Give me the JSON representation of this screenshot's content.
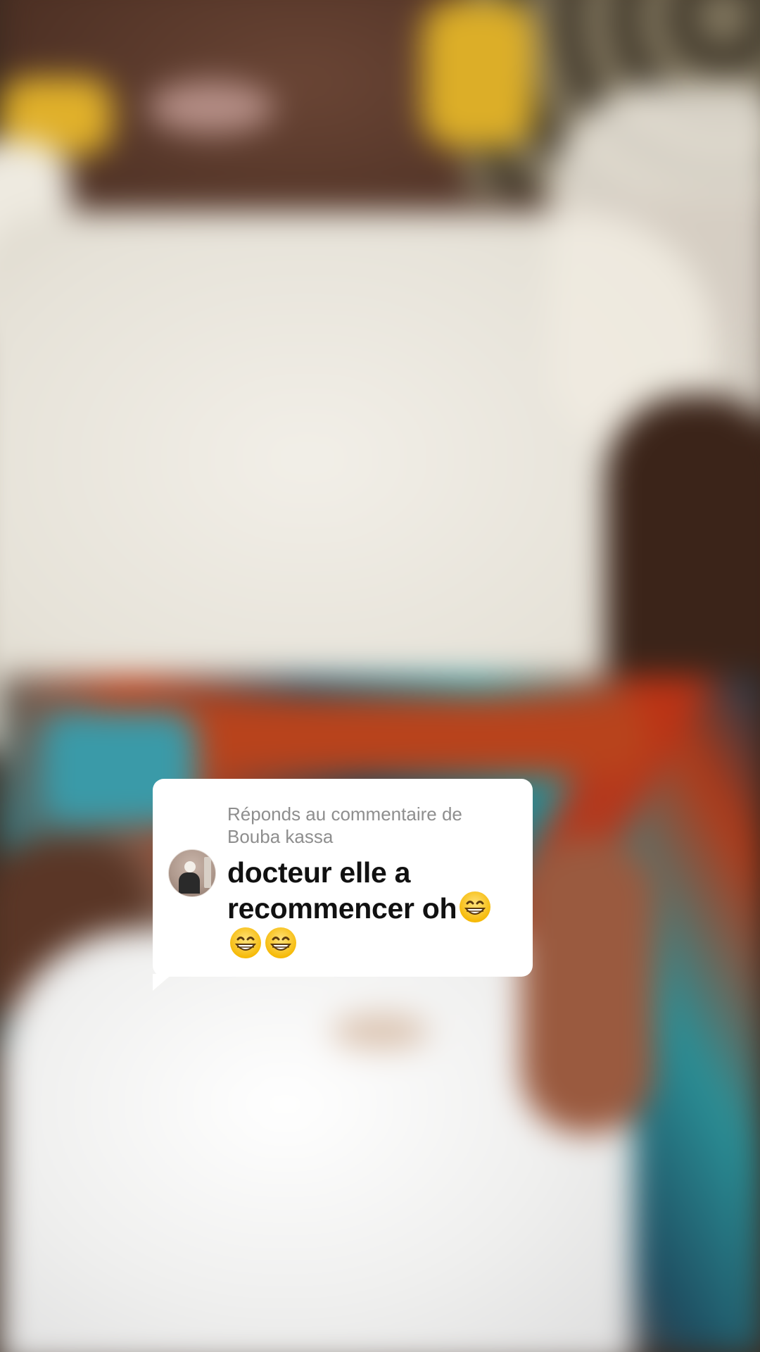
{
  "video": {
    "background_description_colors": {
      "skin": "#4a2e22",
      "dress": "#ece8df",
      "wrap_red": "#b8431c",
      "wrap_teal": "#2f7f8a",
      "beads": "#dcae28"
    }
  },
  "reply_sticker": {
    "header_line1": "Réponds au commentaire de",
    "header_line2": "Bouba kassa",
    "comment_text": "docteur elle a recommencer oh",
    "emojis": [
      "grinning-face-with-smiling-eyes",
      "grinning-face-with-smiling-eyes",
      "grinning-face-with-smiling-eyes"
    ],
    "avatar_icon": "user-avatar"
  }
}
